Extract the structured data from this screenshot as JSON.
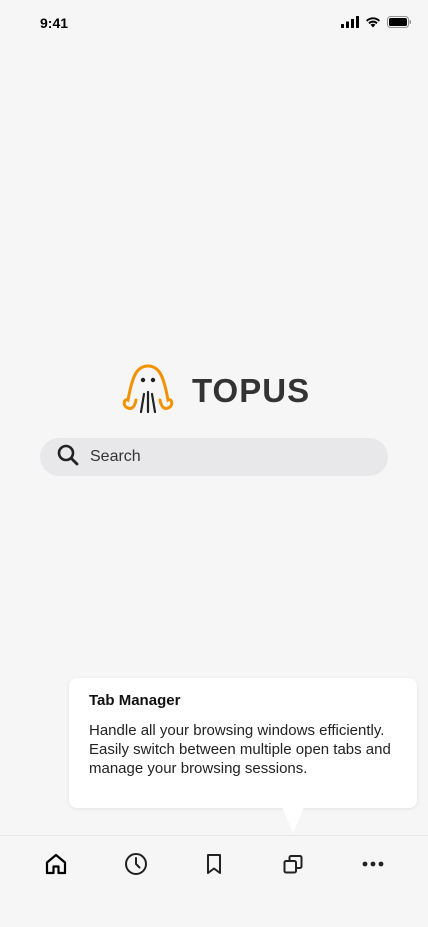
{
  "status_bar": {
    "time": "9:41",
    "icons": [
      "signal-icon",
      "wifi-icon",
      "battery-icon"
    ]
  },
  "brand": {
    "name": "TOPUS",
    "logo_icon": "octopus-logo-icon",
    "accent_color": "#f39200"
  },
  "search": {
    "placeholder": "Search",
    "icon": "search-icon"
  },
  "tooltip": {
    "title": "Tab Manager",
    "body": "Handle all your browsing windows efficiently. Easily switch between multiple open tabs and manage your browsing sessions."
  },
  "bottom_nav": {
    "items": [
      {
        "icon": "home-icon",
        "active": true
      },
      {
        "icon": "history-clock-icon",
        "active": false
      },
      {
        "icon": "bookmark-icon",
        "active": false
      },
      {
        "icon": "tabs-icon",
        "active": false
      },
      {
        "icon": "more-icon",
        "active": false
      }
    ]
  }
}
